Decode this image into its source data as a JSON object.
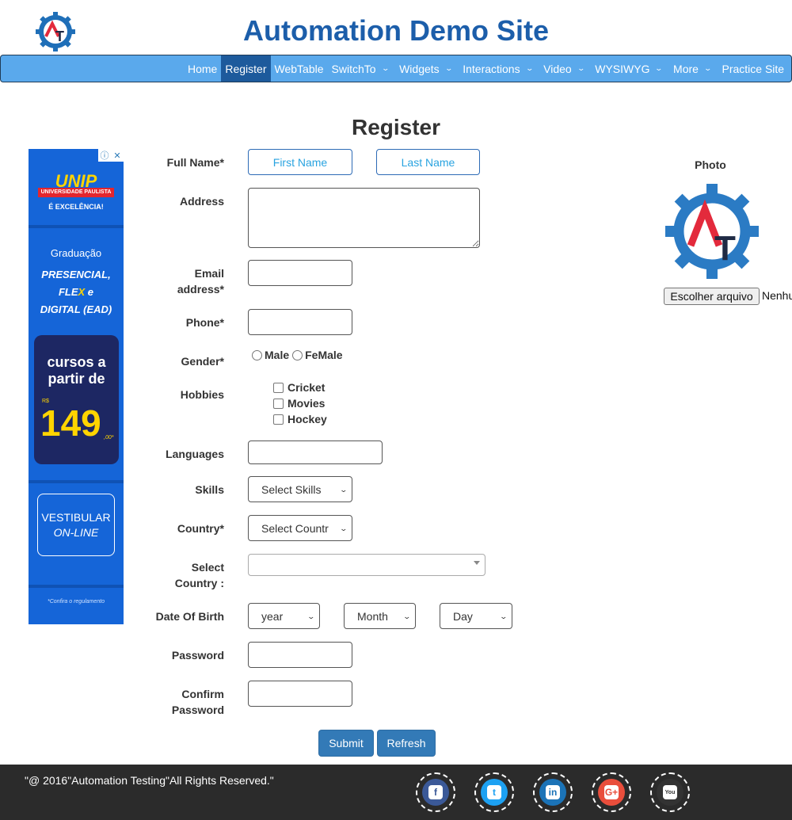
{
  "header": {
    "site_title": "Automation Demo Site",
    "logo_text": "AT"
  },
  "nav": {
    "items": [
      {
        "label": "Home",
        "dropdown": false,
        "active": false
      },
      {
        "label": "Register",
        "dropdown": false,
        "active": true
      },
      {
        "label": "WebTable",
        "dropdown": false,
        "active": false
      },
      {
        "label": "SwitchTo",
        "dropdown": true,
        "active": false
      },
      {
        "label": "Widgets",
        "dropdown": true,
        "active": false
      },
      {
        "label": "Interactions",
        "dropdown": true,
        "active": false
      },
      {
        "label": "Video",
        "dropdown": true,
        "active": false
      },
      {
        "label": "WYSIWYG",
        "dropdown": true,
        "active": false
      },
      {
        "label": "More",
        "dropdown": true,
        "active": false
      },
      {
        "label": "Practice Site",
        "dropdown": false,
        "active": false
      }
    ]
  },
  "page_title": "Register",
  "ad": {
    "brand": "UNIP",
    "brand_sub": "UNIVERSIDADE PAULISTA",
    "tagline": "É EXCELÊNCIA!",
    "graduacao": "Graduação",
    "line1": "PRESENCIAL,",
    "line2a": "FLE",
    "line2b": "X",
    "line2c": " e",
    "line3": "DIGITAL (EAD)",
    "cursos_1": "cursos a",
    "cursos_2": "partir de",
    "currency": "R$",
    "price": "149",
    "cents": ",00*",
    "vest_1": "VESTIBULAR",
    "vest_2": "ON-LINE",
    "footnote": "*Confira o regulamento"
  },
  "form": {
    "full_name_label": "Full Name*",
    "first_name_placeholder": "First Name",
    "last_name_placeholder": "Last Name",
    "address_label": "Address",
    "email_label_1": "Email",
    "email_label_2": "address*",
    "phone_label": "Phone*",
    "gender_label": "Gender*",
    "gender_male": "Male",
    "gender_female": "FeMale",
    "hobbies_label": "Hobbies",
    "hobby_cricket": "Cricket",
    "hobby_movies": "Movies",
    "hobby_hockey": "Hockey",
    "languages_label": "Languages",
    "skills_label": "Skills",
    "skills_value": "Select Skills",
    "country_label": "Country*",
    "country_value": "Select Countr",
    "select_country_label_1": "Select",
    "select_country_label_2": "Country :",
    "dob_label": "Date Of Birth",
    "dob_year": "year",
    "dob_month": "Month",
    "dob_day": "Day",
    "password_label": "Password",
    "confirm_label_1": "Confirm",
    "confirm_label_2": "Password",
    "submit_label": "Submit",
    "refresh_label": "Refresh"
  },
  "photo": {
    "label": "Photo",
    "file_button": "Escolher arquivo",
    "file_status": "Nenhu"
  },
  "footer": {
    "copyright": "\"@ 2016\"Automation Testing\"All Rights Reserved.\"",
    "social": [
      {
        "name": "facebook-icon",
        "color": "#3b5998",
        "glyph": "f"
      },
      {
        "name": "twitter-icon",
        "color": "#1da1f2",
        "glyph": "t"
      },
      {
        "name": "linkedin-icon",
        "color": "#1b73b7",
        "glyph": "in"
      },
      {
        "name": "google-plus-icon",
        "color": "#e94e3c",
        "glyph": "G+"
      },
      {
        "name": "youtube-icon",
        "color": "#333333",
        "glyph": "You"
      }
    ]
  },
  "colors": {
    "title_blue": "#1c5eaa",
    "nav_bg": "#5aa9ec",
    "nav_active": "#1d5a9c",
    "button_blue": "#337ab7",
    "footer_bg": "#2b2b2b"
  }
}
